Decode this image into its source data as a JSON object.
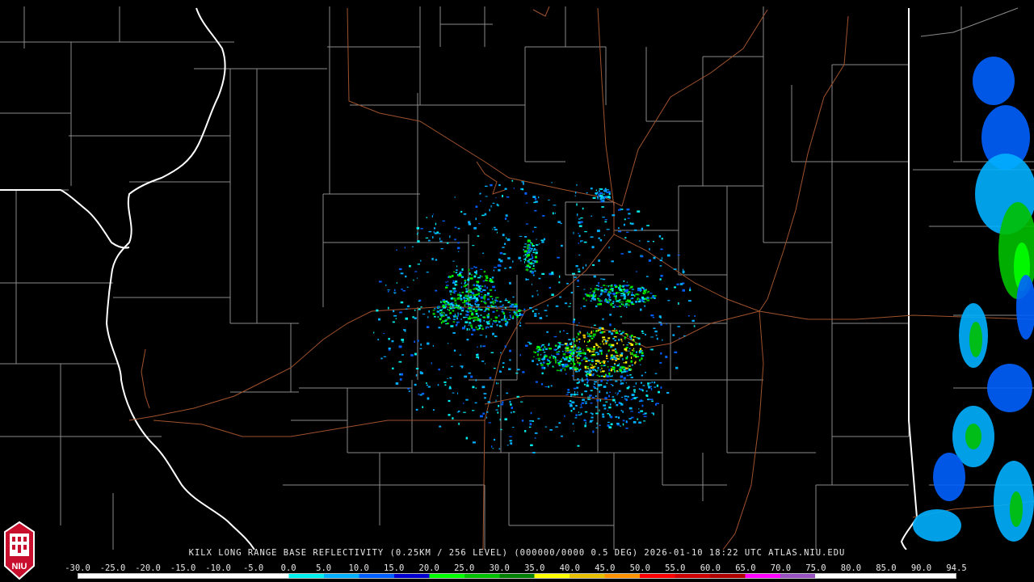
{
  "product": {
    "caption": "KILX LONG RANGE BASE REFLECTIVITY (0.25KM / 256 LEVEL) (000000/0000 0.5 DEG) 2026-01-10 18:22 UTC  ATLAS.NIU.EDU"
  },
  "logo": {
    "text": "NIU",
    "color": "#c8102e"
  },
  "colors": {
    "background": "#000000",
    "county_lines": "#8a8a8a",
    "state_lines": "#ffffff",
    "highways": "#a0522d"
  },
  "scale": {
    "labels": [
      "-30.0",
      "-25.0",
      "-20.0",
      "-15.0",
      "-10.0",
      "-5.0",
      "0.0",
      "5.0",
      "10.0",
      "15.0",
      "20.0",
      "25.0",
      "30.0",
      "35.0",
      "40.0",
      "45.0",
      "50.0",
      "55.0",
      "60.0",
      "65.0",
      "70.0",
      "75.0",
      "80.0",
      "85.0",
      "90.0",
      "94.5"
    ],
    "colors": [
      "#ffffff",
      "#ffffff",
      "#ffffff",
      "#ffffff",
      "#ffffff",
      "#ffffff",
      "#00f0f0",
      "#00b0ff",
      "#0060ff",
      "#0000d0",
      "#00ff00",
      "#00c000",
      "#008000",
      "#ffff00",
      "#e6c000",
      "#ff9000",
      "#ff0000",
      "#d00000",
      "#b00000",
      "#ff00ff",
      "#9950c0",
      "#ffffff",
      "#ffffff",
      "#ffffff",
      "#ffffff"
    ]
  }
}
